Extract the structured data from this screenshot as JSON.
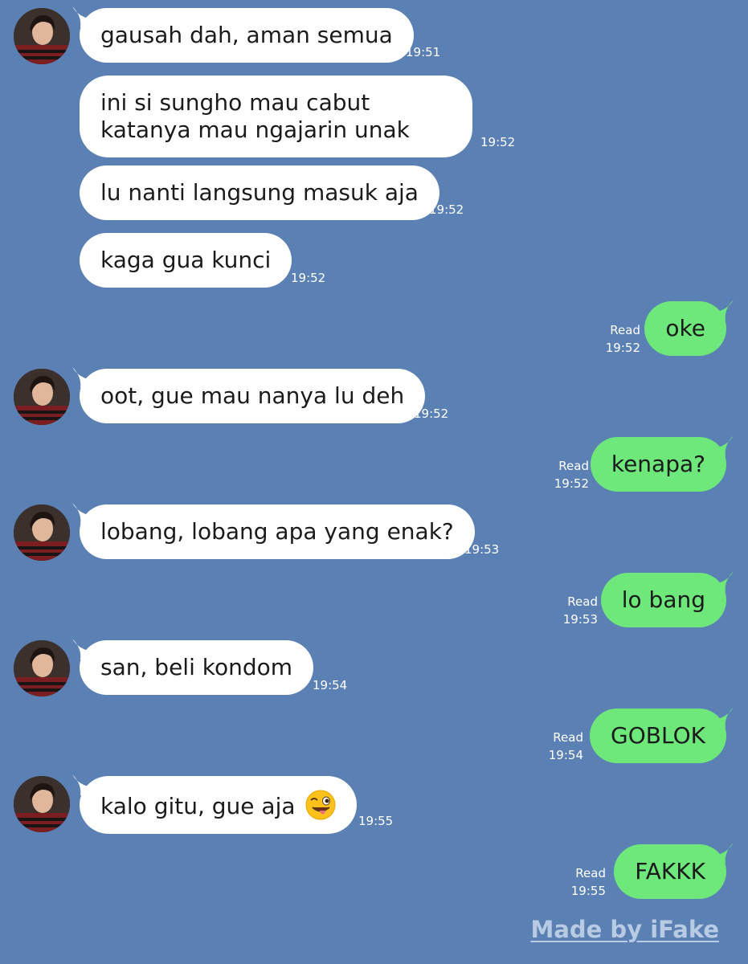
{
  "colors": {
    "background": "#5a80b4",
    "incoming_bubble": "#ffffff",
    "outgoing_bubble": "#6ee77b",
    "meta_text": "#ffffff",
    "watermark": "#b9cbe3"
  },
  "messages": [
    {
      "direction": "in",
      "text": "gausah dah, aman semua",
      "time": "19:51",
      "avatar": true
    },
    {
      "direction": "in",
      "text": "ini si sungho mau cabut katanya mau ngajarin unak",
      "time": "19:52",
      "avatar": false
    },
    {
      "direction": "in",
      "text": "lu nanti langsung masuk aja",
      "time": "19:52",
      "avatar": false
    },
    {
      "direction": "in",
      "text": "kaga gua kunci",
      "time": "19:52",
      "avatar": false
    },
    {
      "direction": "out",
      "text": "oke",
      "status": "Read",
      "time": "19:52"
    },
    {
      "direction": "in",
      "text": "oot, gue mau nanya lu deh",
      "time": "19:52",
      "avatar": true
    },
    {
      "direction": "out",
      "text": "kenapa?",
      "status": "Read",
      "time": "19:52"
    },
    {
      "direction": "in",
      "text": "lobang, lobang apa yang enak?",
      "time": "19:53",
      "avatar": true
    },
    {
      "direction": "out",
      "text": "lo bang",
      "status": "Read",
      "time": "19:53"
    },
    {
      "direction": "in",
      "text": "san, beli kondom",
      "time": "19:54",
      "avatar": true
    },
    {
      "direction": "out",
      "text": "GOBLOK",
      "status": "Read",
      "time": "19:54"
    },
    {
      "direction": "in",
      "text": "kalo gitu, gue aja",
      "emoji": "winking-face-with-tongue-icon",
      "time": "19:55",
      "avatar": true
    },
    {
      "direction": "out",
      "text": "FAKKK",
      "status": "Read",
      "time": "19:55"
    }
  ],
  "watermark": "Made by iFake"
}
